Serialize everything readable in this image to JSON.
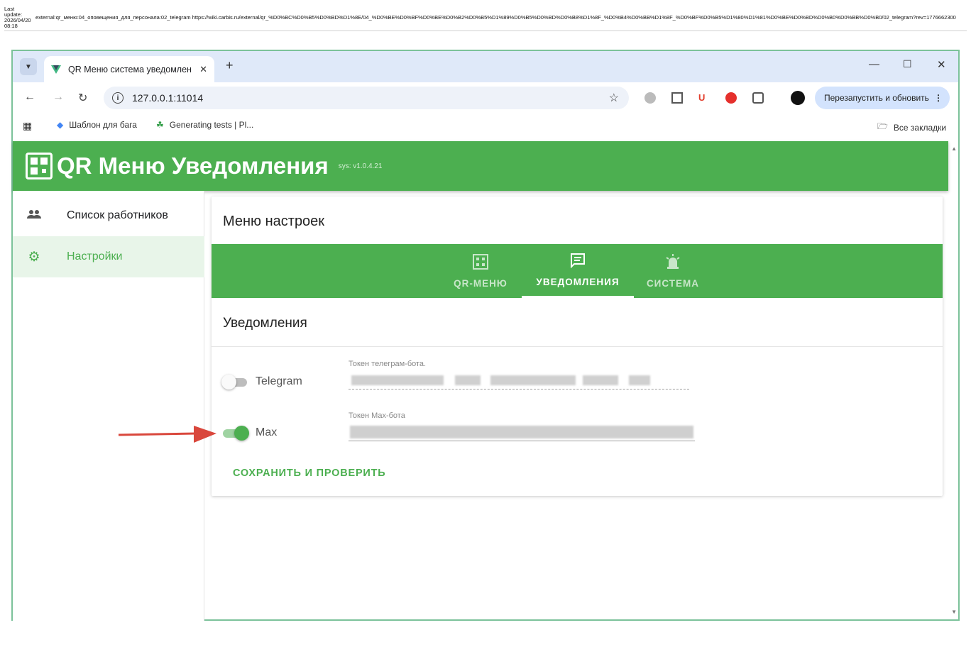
{
  "wiki": {
    "meta_line1": "Last",
    "meta_line2": "update:",
    "meta_line3": "2026/04/20",
    "meta_line4": "08:18",
    "path": "external:qr_меню:04_оповещения_для_персонала:02_telegram https://wiki.carbis.ru/external/qr_%D0%BC%D0%B5%D0%BD%D1%8E/04_%D0%BE%D0%BF%D0%BE%D0%B2%D0%B5%D1%89%D0%B5%D0%BD%D0%B8%D1%8F_%D0%B4%D0%BB%D1%8F_%D0%BF%D0%B5%D1%80%D1%81%D0%BE%D0%BD%D0%B0%D0%BB%D0%B0/02_telegram?rev=1776662300"
  },
  "browser": {
    "tab_title": "QR Меню система уведомлен",
    "url": "127.0.0.1:11014",
    "relaunch_label": "Перезапустить и обновить",
    "bookmarks": [
      "Шаблон для бага",
      "Generating tests | Pl..."
    ],
    "all_bookmarks": "Все закладки"
  },
  "app": {
    "title": "QR Меню Уведомления",
    "version": "sys: v1.0.4.21"
  },
  "sidebar": {
    "items": [
      {
        "label": "Список работников",
        "icon": "people-icon"
      },
      {
        "label": "Настройки",
        "icon": "gear-icon"
      }
    ]
  },
  "settings": {
    "title": "Меню настроек",
    "tabs": [
      {
        "label": "QR-МЕНЮ",
        "icon": "qr-icon"
      },
      {
        "label": "УВЕДОМЛЕНИЯ",
        "icon": "message-icon"
      },
      {
        "label": "СИСТЕМА",
        "icon": "alarm-icon"
      }
    ],
    "active_tab": "УВЕДОМЛЕНИЯ",
    "section_title": "Уведомления",
    "channels": [
      {
        "label": "Telegram",
        "enabled": false,
        "token_label": "Токен телеграм-бота."
      },
      {
        "label": "Max",
        "enabled": true,
        "token_label": "Токен Max-бота"
      }
    ],
    "save_label": "СОХРАНИТЬ И ПРОВЕРИТЬ"
  },
  "colors": {
    "accent": "#4caf50",
    "arrow": "#d9473c"
  }
}
